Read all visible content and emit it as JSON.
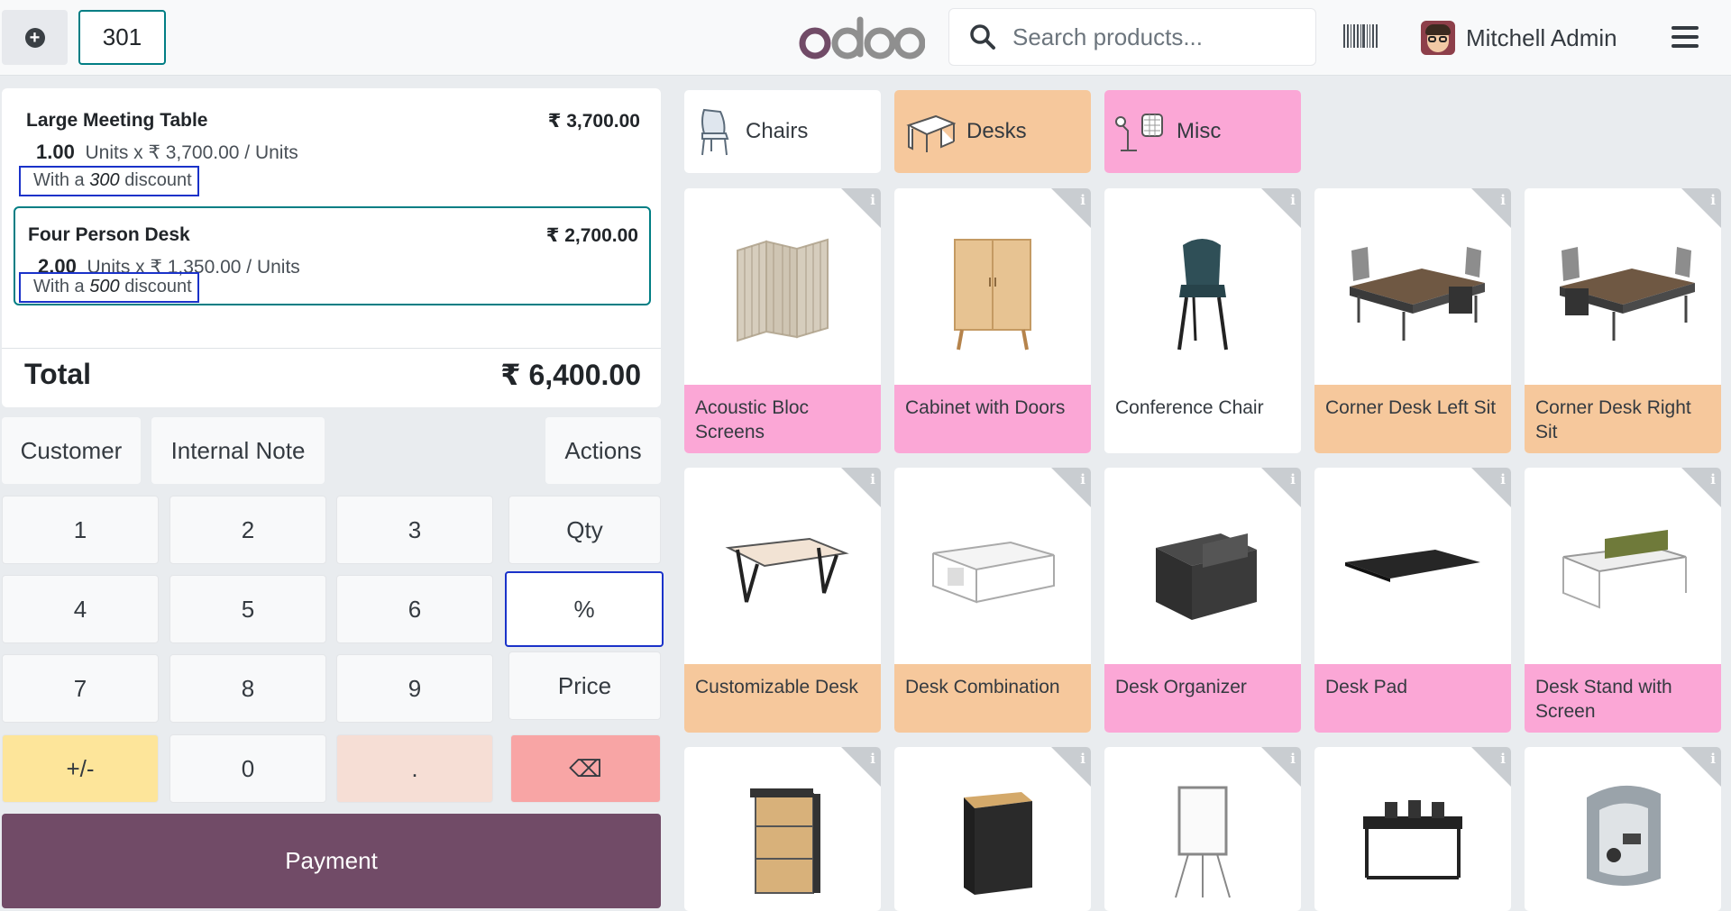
{
  "topbar": {
    "new_order_icon": "plus-circle-icon",
    "order_number": "301",
    "logo_text": "odoo",
    "search_placeholder": "Search products...",
    "barcode_icon": "barcode-icon",
    "user_name": "Mitchell Admin",
    "menu_icon": "hamburger-menu-icon"
  },
  "order": {
    "lines": [
      {
        "name": "Large Meeting Table",
        "price": "₹ 3,700.00",
        "qty": "1.00",
        "qty_detail": "Units x ₹ 3,700.00 / Units",
        "discount_prefix": "With a",
        "discount_value": "300",
        "discount_suffix": "discount"
      },
      {
        "name": "Four Person Desk",
        "price": "₹ 2,700.00",
        "qty": "2.00",
        "qty_detail": "Units x ₹ 1,350.00 / Units",
        "discount_prefix": "With a",
        "discount_value": "500",
        "discount_suffix": "discount"
      }
    ],
    "total_label": "Total",
    "total_value": "₹ 6,400.00"
  },
  "controls": {
    "customer": "Customer",
    "internal_note": "Internal Note",
    "actions": "Actions"
  },
  "numpad": {
    "k1": "1",
    "k2": "2",
    "k3": "3",
    "qty": "Qty",
    "k4": "4",
    "k5": "5",
    "k6": "6",
    "percent": "%",
    "k7": "7",
    "k8": "8",
    "k9": "9",
    "price": "Price",
    "sign": "+/-",
    "k0": "0",
    "dot": ".",
    "backspace": "⌫",
    "selected_mode": "%"
  },
  "payment_label": "Payment",
  "categories": [
    {
      "name": "Chairs",
      "color": "#ffffff"
    },
    {
      "name": "Desks",
      "color": "#f6c89c"
    },
    {
      "name": "Misc",
      "color": "#fba7d6"
    }
  ],
  "products": [
    {
      "name": "Acoustic Bloc Screens",
      "color": "pink"
    },
    {
      "name": "Cabinet with Doors",
      "color": "pink"
    },
    {
      "name": "Conference Chair",
      "color": "white"
    },
    {
      "name": "Corner Desk Left Sit",
      "color": "orange"
    },
    {
      "name": "Corner Desk Right Sit",
      "color": "orange"
    },
    {
      "name": "Customizable Desk",
      "color": "orange"
    },
    {
      "name": "Desk Combination",
      "color": "orange"
    },
    {
      "name": "Desk Organizer",
      "color": "pink"
    },
    {
      "name": "Desk Pad",
      "color": "pink"
    },
    {
      "name": "Desk Stand with Screen",
      "color": "pink"
    },
    {
      "name": "",
      "color": "white"
    },
    {
      "name": "",
      "color": "white"
    },
    {
      "name": "",
      "color": "white"
    },
    {
      "name": "",
      "color": "white"
    },
    {
      "name": "",
      "color": "white"
    }
  ],
  "product_info_label": "i"
}
